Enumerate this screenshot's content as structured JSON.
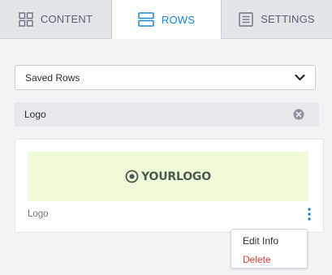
{
  "tabs": [
    {
      "label": "CONTENT",
      "icon": "grid-icon",
      "active": false
    },
    {
      "label": "ROWS",
      "icon": "rows-icon",
      "active": true
    },
    {
      "label": "SETTINGS",
      "icon": "settings-list-icon",
      "active": false
    }
  ],
  "filter": {
    "selected": "Saved Rows",
    "chevron_icon": "chevron-down-icon"
  },
  "search": {
    "value": "Logo",
    "clear_icon": "clear-icon"
  },
  "row_card": {
    "preview_logo_text": "YOURLOGO",
    "label": "Logo",
    "more_icon": "kebab-menu-icon"
  },
  "context_menu": {
    "edit_label": "Edit Info",
    "delete_label": "Delete"
  },
  "colors": {
    "accent": "#1a87d8",
    "danger": "#d9403a",
    "preview_bg": "#eefad8"
  }
}
